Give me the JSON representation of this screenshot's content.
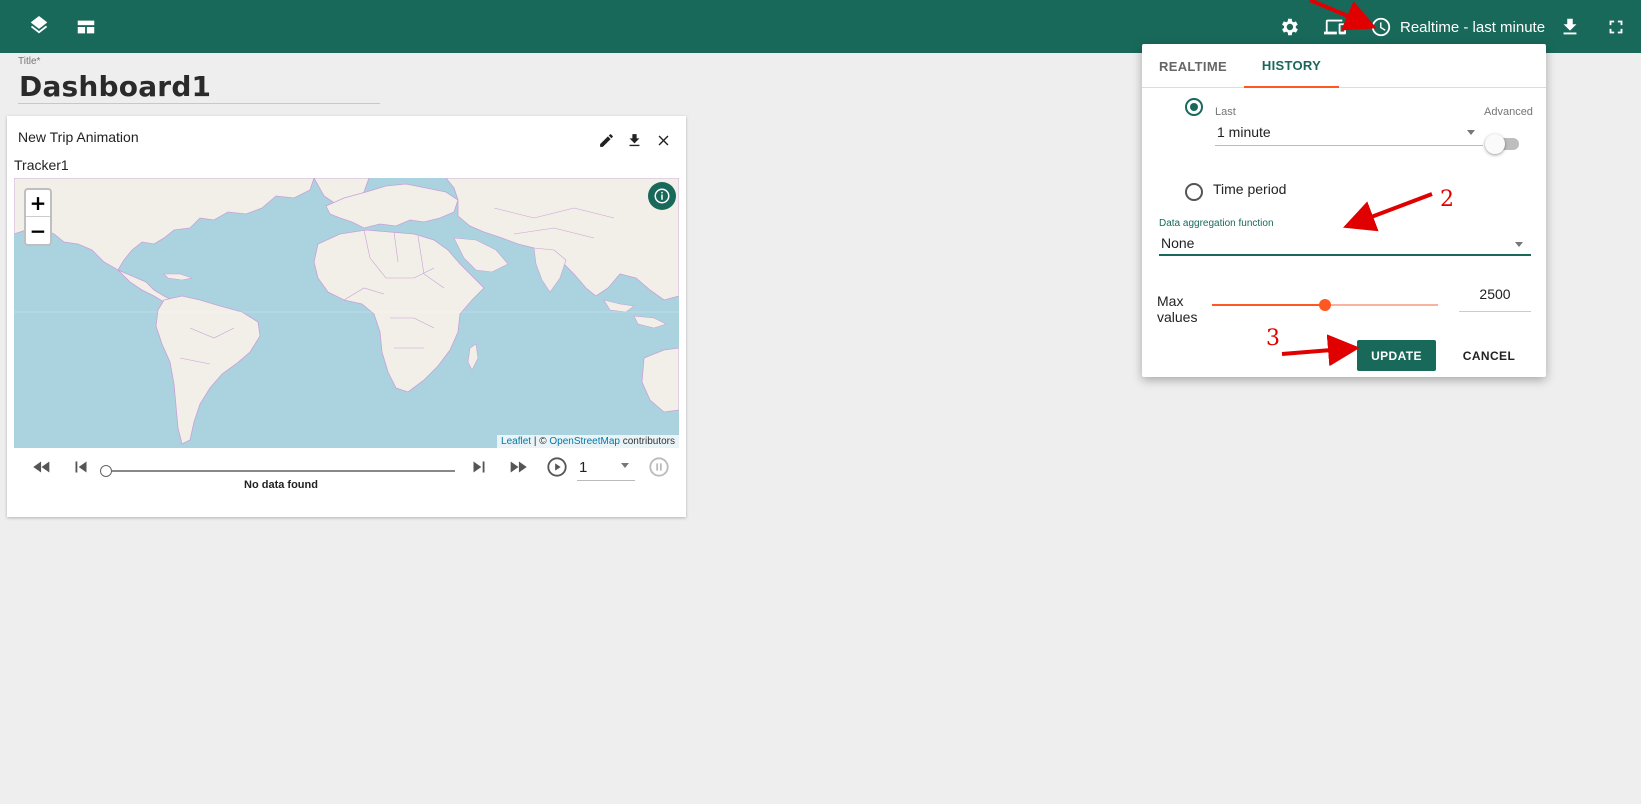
{
  "toolbar": {
    "time_window_label": "Realtime - last minute",
    "icons": [
      "layers-icon",
      "dashboard-layout-icon",
      "settings-icon",
      "devices-icon",
      "clock-icon",
      "download-icon",
      "fullscreen-icon"
    ]
  },
  "title_field": {
    "label": "Title",
    "required_mark": "*",
    "value": "Dashboard1"
  },
  "widget": {
    "title": "New Trip Animation",
    "actions": [
      "edit-icon",
      "download-icon",
      "close-icon"
    ],
    "tracker_label": "Tracker1",
    "map": {
      "zoom_in": "+",
      "zoom_out": "−",
      "attribution": {
        "leaflet": "Leaflet",
        "separator": " | © ",
        "osm": "OpenStreetMap",
        "suffix": " contributors"
      }
    },
    "controls": {
      "status": "No data found",
      "speed_value": "1"
    }
  },
  "time_panel": {
    "tabs": [
      {
        "label": "REALTIME",
        "active": false
      },
      {
        "label": "HISTORY",
        "active": true
      }
    ],
    "last": {
      "label": "Last",
      "value": "1 minute",
      "selected": true
    },
    "advanced_label": "Advanced",
    "advanced_on": false,
    "time_period": {
      "label": "Time period",
      "selected": false
    },
    "aggregation": {
      "label": "Data aggregation function",
      "value": "None"
    },
    "max_values": {
      "label": "Max values",
      "value": "2500",
      "slider_fraction": 0.5
    },
    "update_label": "UPDATE",
    "cancel_label": "CANCEL"
  },
  "annotations": {
    "step2": "2",
    "step3": "3",
    "arrow_color": "#e00000"
  },
  "colors": {
    "primary": "#19695b",
    "accent": "#ff5722",
    "background": "#eeeeee"
  }
}
